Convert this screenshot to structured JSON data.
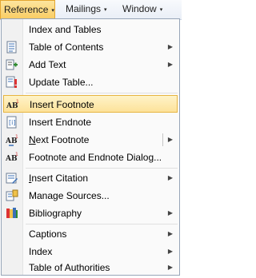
{
  "menubar": {
    "reference": "Reference",
    "mailings": "Mailings",
    "window": "Window",
    "caret": "▾"
  },
  "menu": {
    "items": [
      {
        "label": "Index and Tables",
        "icon": "",
        "submenu": false
      },
      {
        "label": "Table of Contents",
        "icon": "table-of-contents-icon",
        "submenu": true
      },
      {
        "label": "Add Text",
        "icon": "add-text-icon",
        "submenu": true
      },
      {
        "label": "Update Table...",
        "icon": "update-table-icon",
        "submenu": false
      },
      {
        "label": "Insert Footnote",
        "icon": "insert-footnote-icon",
        "submenu": false,
        "highlighted": true
      },
      {
        "label": "Insert Endnote",
        "icon": "insert-endnote-icon",
        "submenu": false
      },
      {
        "label_prefix": "N",
        "label_rest": "ext Footnote",
        "icon": "next-footnote-icon",
        "submenu": true,
        "split": true
      },
      {
        "label": "Footnote and Endnote Dialog...",
        "icon": "footnote-dialog-icon",
        "submenu": false
      },
      {
        "label_prefix": "I",
        "label_rest": "nsert Citation",
        "icon": "insert-citation-icon",
        "submenu": true
      },
      {
        "label": "Manage Sources...",
        "icon": "manage-sources-icon",
        "submenu": false
      },
      {
        "label": "Bibliography",
        "icon": "bibliography-icon",
        "submenu": true
      },
      {
        "label": "Captions",
        "icon": "",
        "submenu": true
      },
      {
        "label": "Index",
        "icon": "",
        "submenu": true
      },
      {
        "label": "Table of Authorities",
        "icon": "",
        "submenu": true
      }
    ],
    "submenu_arrow": "▶"
  },
  "colors": {
    "highlight": "#fde29a",
    "accent": "#e7b541",
    "icon_blue": "#3b6fb6"
  }
}
